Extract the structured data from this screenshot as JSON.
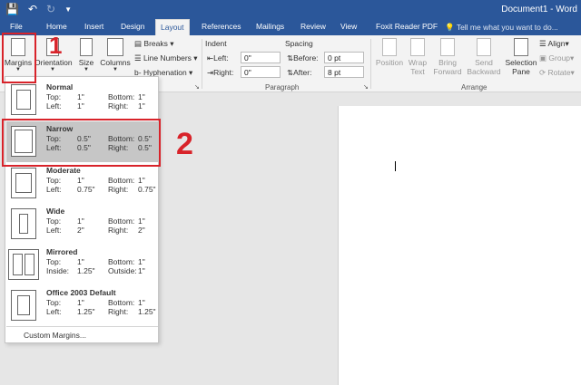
{
  "titlebar": {
    "title": "Document1 - Word"
  },
  "tabs": [
    "File",
    "Home",
    "Insert",
    "Design",
    "Layout",
    "References",
    "Mailings",
    "Review",
    "View",
    "Foxit Reader PDF"
  ],
  "active_tab": "Layout",
  "tellme": "Tell me what you want to do...",
  "ribbon": {
    "margins": "Margins",
    "orientation": "Orientation",
    "size": "Size",
    "columns": "Columns",
    "breaks": "Breaks",
    "line_numbers": "Line Numbers",
    "hyphenation": "Hyphenation",
    "indent_title": "Indent",
    "indent_left": "Left:",
    "indent_left_val": "0\"",
    "indent_right": "Right:",
    "indent_right_val": "0\"",
    "spacing_title": "Spacing",
    "before": "Before:",
    "before_val": "0 pt",
    "after": "After:",
    "after_val": "8 pt",
    "paragraph_group": "Paragraph",
    "position": "Position",
    "wrap_text": "Wrap Text",
    "bring_forward": "Bring Forward",
    "send_backward": "Send Backward",
    "selection_pane": "Selection Pane",
    "align": "Align",
    "group": "Group",
    "rotate": "Rotate",
    "arrange_group": "Arrange"
  },
  "margins_menu": {
    "items": [
      {
        "name": "Normal",
        "l1": "Top:",
        "v1": "1\"",
        "l2": "Bottom:",
        "v2": "1\"",
        "l3": "Left:",
        "v3": "1\"",
        "l4": "Right:",
        "v4": "1\""
      },
      {
        "name": "Narrow",
        "l1": "Top:",
        "v1": "0.5\"",
        "l2": "Bottom:",
        "v2": "0.5\"",
        "l3": "Left:",
        "v3": "0.5\"",
        "l4": "Right:",
        "v4": "0.5\""
      },
      {
        "name": "Moderate",
        "l1": "Top:",
        "v1": "1\"",
        "l2": "Bottom:",
        "v2": "1\"",
        "l3": "Left:",
        "v3": "0.75\"",
        "l4": "Right:",
        "v4": "0.75\""
      },
      {
        "name": "Wide",
        "l1": "Top:",
        "v1": "1\"",
        "l2": "Bottom:",
        "v2": "1\"",
        "l3": "Left:",
        "v3": "2\"",
        "l4": "Right:",
        "v4": "2\""
      },
      {
        "name": "Mirrored",
        "l1": "Top:",
        "v1": "1\"",
        "l2": "Bottom:",
        "v2": "1\"",
        "l3": "Inside:",
        "v3": "1.25\"",
        "l4": "Outside:",
        "v4": "1\""
      },
      {
        "name": "Office 2003 Default",
        "l1": "Top:",
        "v1": "1\"",
        "l2": "Bottom:",
        "v2": "1\"",
        "l3": "Left:",
        "v3": "1.25\"",
        "l4": "Right:",
        "v4": "1.25\""
      }
    ],
    "custom": "Custom Margins..."
  },
  "annotations": {
    "one": "1",
    "two": "2"
  },
  "colors": {
    "accent": "#2b579a",
    "highlight": "#d8232a"
  }
}
